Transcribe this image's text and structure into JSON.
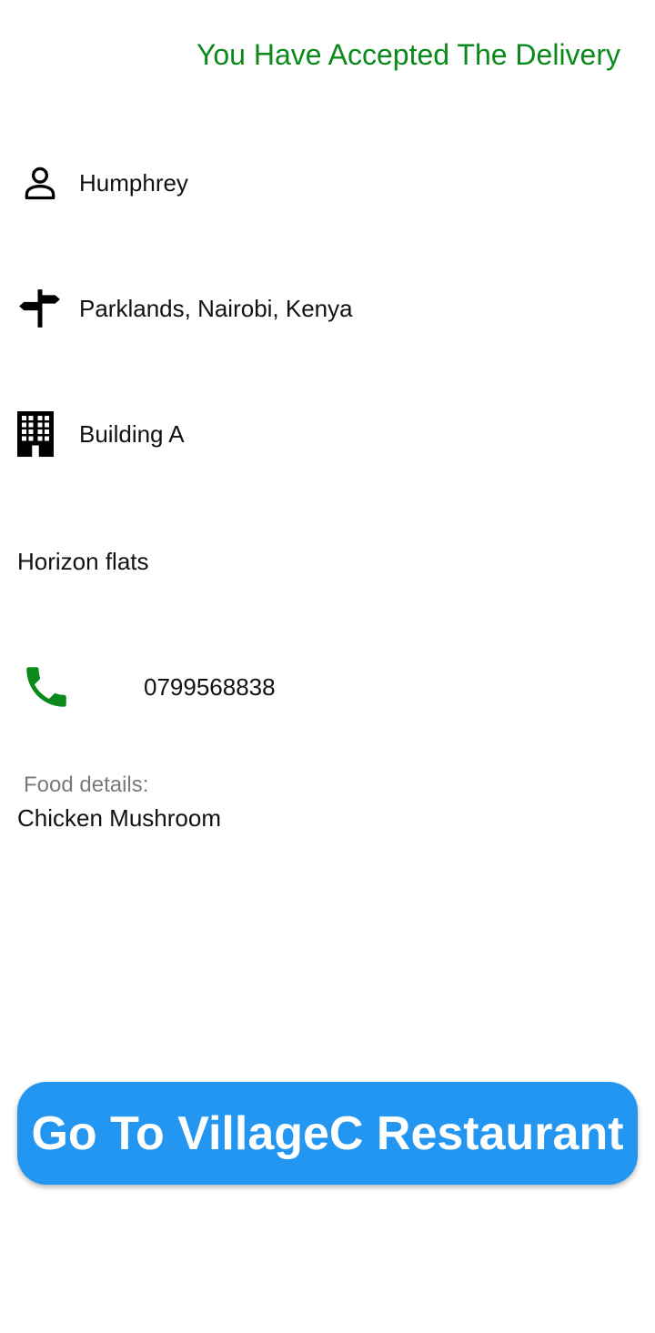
{
  "header": {
    "status_message": "You Have Accepted The Delivery"
  },
  "customer": {
    "name": "Humphrey",
    "name_icon": "person-icon"
  },
  "address": {
    "location": "Parklands, Nairobi, Kenya",
    "location_icon": "signpost-icon",
    "building": "Building A",
    "building_icon": "building-icon",
    "apartment": "Horizon flats"
  },
  "contact": {
    "phone": "0799568838",
    "phone_icon": "phone-icon",
    "phone_icon_color": "#0a8a1a"
  },
  "food": {
    "label": "Food details:",
    "items": "Chicken Mushroom"
  },
  "action": {
    "button_label": "Go To VillageC Restaurant",
    "button_color": "#2296f0"
  },
  "colors": {
    "status_green": "#0a8a1a",
    "accent_blue": "#2296f0"
  }
}
